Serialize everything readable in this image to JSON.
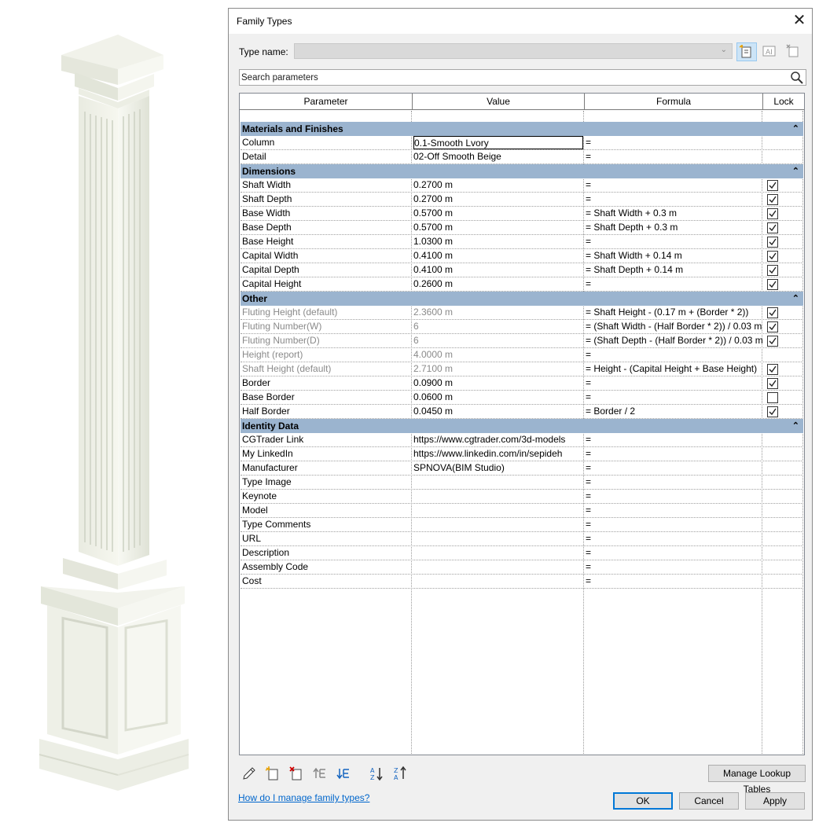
{
  "dialog": {
    "title": "Family Types",
    "close_glyph": "✕",
    "type_name_label": "Type name:",
    "type_name_value": "",
    "search_placeholder": "Search parameters"
  },
  "columns": {
    "parameter": "Parameter",
    "value": "Value",
    "formula": "Formula",
    "lock": "Lock"
  },
  "groups": [
    {
      "label": "Materials and Finishes",
      "rows": [
        {
          "param": "Column",
          "value": "0.1-Smooth Lvory",
          "formula": "=",
          "lock": "none",
          "muted": false,
          "editing": true
        },
        {
          "param": "Detail",
          "value": "02-Off Smooth Beige",
          "formula": "=",
          "lock": "none",
          "muted": false
        }
      ]
    },
    {
      "label": "Dimensions",
      "rows": [
        {
          "param": "Shaft Width",
          "value": "0.2700 m",
          "formula": "=",
          "lock": "checked",
          "muted": false
        },
        {
          "param": "Shaft Depth",
          "value": "0.2700 m",
          "formula": "=",
          "lock": "checked",
          "muted": false
        },
        {
          "param": "Base Width",
          "value": "0.5700 m",
          "formula": "= Shaft Width + 0.3 m",
          "lock": "checked",
          "muted": false
        },
        {
          "param": "Base Depth",
          "value": "0.5700 m",
          "formula": "= Shaft Depth + 0.3 m",
          "lock": "checked",
          "muted": false
        },
        {
          "param": "Base Height",
          "value": "1.0300 m",
          "formula": "=",
          "lock": "checked",
          "muted": false
        },
        {
          "param": "Capital Width",
          "value": "0.4100 m",
          "formula": "= Shaft Width + 0.14 m",
          "lock": "checked",
          "muted": false
        },
        {
          "param": "Capital Depth",
          "value": "0.4100 m",
          "formula": "= Shaft Depth + 0.14 m",
          "lock": "checked",
          "muted": false
        },
        {
          "param": "Capital Height",
          "value": "0.2600 m",
          "formula": "=",
          "lock": "checked",
          "muted": false
        }
      ]
    },
    {
      "label": "Other",
      "rows": [
        {
          "param": "Fluting Height (default)",
          "value": "2.3600 m",
          "formula": "= Shaft Height - (0.17 m + (Border * 2))",
          "lock": "checked",
          "muted": true
        },
        {
          "param": "Fluting Number(W)",
          "value": "6",
          "formula": "= (Shaft Width - (Half Border * 2)) / 0.03 m",
          "lock": "checked",
          "muted": true
        },
        {
          "param": "Fluting Number(D)",
          "value": "6",
          "formula": "= (Shaft Depth - (Half Border * 2)) / 0.03 m",
          "lock": "checked",
          "muted": true
        },
        {
          "param": "Height (report)",
          "value": "4.0000 m",
          "formula": "=",
          "lock": "none",
          "muted": true
        },
        {
          "param": "Shaft Height (default)",
          "value": "2.7100 m",
          "formula": "= Height - (Capital Height + Base Height)",
          "lock": "checked",
          "muted": true
        },
        {
          "param": "Border",
          "value": "0.0900 m",
          "formula": "=",
          "lock": "checked",
          "muted": false
        },
        {
          "param": "Base Border",
          "value": "0.0600 m",
          "formula": "=",
          "lock": "unchecked",
          "muted": false
        },
        {
          "param": "Half Border",
          "value": "0.0450 m",
          "formula": "= Border / 2",
          "lock": "checked",
          "muted": false
        }
      ]
    },
    {
      "label": "Identity Data",
      "rows": [
        {
          "param": "CGTrader Link",
          "value": "https://www.cgtrader.com/3d-models",
          "formula": "=",
          "lock": "none",
          "muted": false
        },
        {
          "param": "My LinkedIn",
          "value": "https://www.linkedin.com/in/sepideh",
          "formula": "=",
          "lock": "none",
          "muted": false
        },
        {
          "param": "Manufacturer",
          "value": "SPNOVA(BIM Studio)",
          "formula": "=",
          "lock": "none",
          "muted": false
        },
        {
          "param": "Type Image",
          "value": "",
          "formula": "=",
          "lock": "none",
          "muted": false
        },
        {
          "param": "Keynote",
          "value": "",
          "formula": "=",
          "lock": "none",
          "muted": false
        },
        {
          "param": "Model",
          "value": "",
          "formula": "=",
          "lock": "none",
          "muted": false
        },
        {
          "param": "Type Comments",
          "value": "",
          "formula": "=",
          "lock": "none",
          "muted": false
        },
        {
          "param": "URL",
          "value": "",
          "formula": "=",
          "lock": "none",
          "muted": false
        },
        {
          "param": "Description",
          "value": "",
          "formula": "=",
          "lock": "none",
          "muted": false
        },
        {
          "param": "Assembly Code",
          "value": "",
          "formula": "=",
          "lock": "none",
          "muted": false
        },
        {
          "param": "Cost",
          "value": "",
          "formula": "=",
          "lock": "none",
          "muted": false
        }
      ]
    }
  ],
  "collapse_glyph": "⌃",
  "buttons": {
    "manage_lookup": "Manage Lookup Tables",
    "ok": "OK",
    "cancel": "Cancel",
    "apply": "Apply"
  },
  "help_link": "How do I manage family types?",
  "icons": {
    "toolbar": [
      "new-type-icon",
      "rename-type-icon",
      "delete-type-icon"
    ],
    "bottom": [
      "edit-parameter-icon",
      "new-parameter-icon",
      "delete-parameter-icon",
      "move-up-icon",
      "move-down-icon",
      "sort-ascending-icon",
      "sort-descending-icon"
    ]
  },
  "colors": {
    "group_header": "#9bb4cf",
    "link": "#0066cc",
    "primary_border": "#0078d7"
  }
}
